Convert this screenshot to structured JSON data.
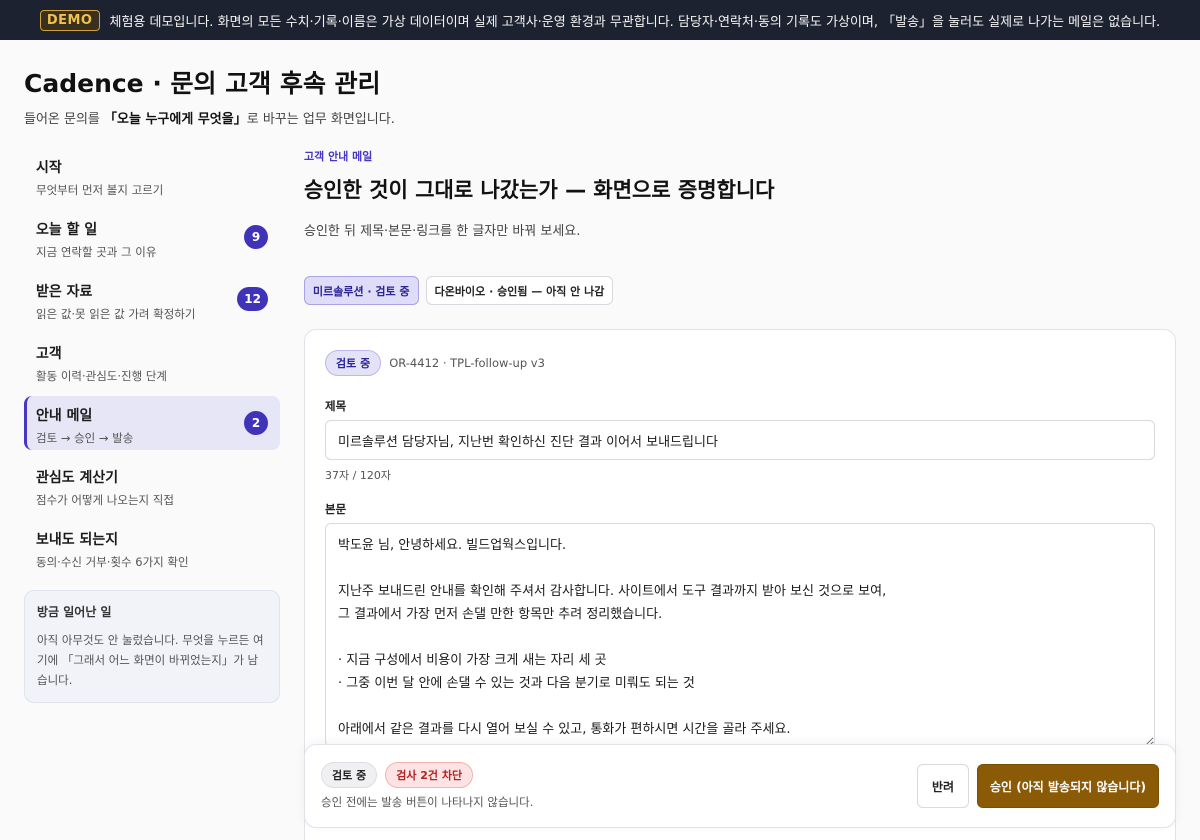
{
  "demo": {
    "badge": "DEMO",
    "notice": "체험용 데모입니다. 화면의 모든 수치·기록·이름은 가상 데이터이며 실제 고객사·운영 환경과 무관합니다. 담당자·연락처·동의 기록도 가상이며, 「발송」을 눌러도 실제로 나가는 메일은 없습니다."
  },
  "app": {
    "title": "Cadence · 문의 고객 후속 관리",
    "subtitle_pre": "들어온 문의를 ",
    "subtitle_bold": "「오늘 누구에게 무엇을」",
    "subtitle_post": "로 바꾸는 업무 화면입니다."
  },
  "sidebar": {
    "items": [
      {
        "title": "시작",
        "desc": "무엇부터 먼저 볼지 고르기",
        "count": ""
      },
      {
        "title": "오늘 할 일",
        "desc": "지금 연락할 곳과 그 이유",
        "count": "9"
      },
      {
        "title": "받은 자료",
        "desc": "읽은 값·못 읽은 값 가려 확정하기",
        "count": "12"
      },
      {
        "title": "고객",
        "desc": "활동 이력·관심도·진행 단계",
        "count": ""
      },
      {
        "title": "안내 메일",
        "desc": "검토 → 승인 → 발송",
        "count": "2"
      },
      {
        "title": "관심도 계산기",
        "desc": "점수가 어떻게 나오는지 직접",
        "count": ""
      },
      {
        "title": "보내도 되는지",
        "desc": "동의·수신 거부·횟수 6가지 확인",
        "count": ""
      }
    ],
    "recent": {
      "title": "방금 일어난 일",
      "text": "아직 아무것도 안 눌렀습니다. 무엇을 누르든 여기에 「그래서 어느 화면이 바뀌었는지」가 남습니다."
    }
  },
  "main": {
    "eyebrow": "고객 안내 메일",
    "title": "승인한 것이 그대로 나갔는가 — 화면으로 증명합니다",
    "subtitle": "승인한 뒤 제목·본문·링크를 한 글자만 바꿔 보세요.",
    "tabs": [
      {
        "label": "미르솔루션 · 검토 중"
      },
      {
        "label": "다온바이오 · 승인됨 — 아직 안 나감"
      }
    ]
  },
  "draft": {
    "status": "검토 중",
    "ref": "OR-4412 · TPL-follow-up v3",
    "subject_label": "제목",
    "subject_value": "미르솔루션 담당자님, 지난번 확인하신 진단 결과 이어서 보내드립니다",
    "char_count": "37자 / 120자",
    "body_label": "본문",
    "body_value": "박도윤 님, 안녕하세요. 빌드업웍스입니다.\n\n지난주 보내드린 안내를 확인해 주셔서 감사합니다. 사이트에서 도구 결과까지 받아 보신 것으로 보여,\n그 결과에서 가장 먼저 손댈 만한 항목만 추려 정리했습니다.\n\n· 지금 구성에서 비용이 가장 크게 새는 자리 세 곳\n· 그중 이번 달 안에 손댈 수 있는 것과 다음 분기로 미뤄도 되는 것\n\n아래에서 같은 결과를 다시 열어 보실 수 있고, 통화가 편하시면 시간을 골라 주세요."
  },
  "action_bar": {
    "status": "검토 중",
    "blocked": "검사 2건 차단",
    "note": "승인 전에는 발송 버튼이 나타나지 않습니다.",
    "reject_label": "반려",
    "approve_label": "승인 (아직 발송되지 않습니다)"
  },
  "colors": {
    "accent": "#4536c6",
    "approve": "#8a5a06",
    "danger": "#b42323",
    "demo_bar": "#1c2230"
  }
}
